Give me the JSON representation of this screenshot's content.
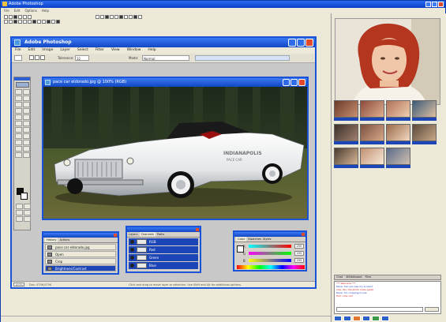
{
  "outer": {
    "title": "Adobe Photoshop",
    "menu": [
      "File",
      "Edit",
      "Options",
      "Help"
    ]
  },
  "photoshop": {
    "title": "Adobe Photoshop",
    "menu": [
      "File",
      "Edit",
      "Image",
      "Layer",
      "Select",
      "Filter",
      "View",
      "Window",
      "Help"
    ],
    "options": {
      "tolerance_label": "Tolerance:",
      "tolerance_value": "32",
      "mode_label": "Mode:",
      "mode_value": "Normal"
    }
  },
  "document": {
    "title": "pace car eldorado.jpg @ 100% (RGB)"
  },
  "history_palette": {
    "tabs": [
      "History",
      "Actions"
    ],
    "rows": [
      {
        "label": "pace car eldorado.jpg"
      },
      {
        "label": "Open"
      },
      {
        "label": "Crop"
      },
      {
        "label": "Brightness/Contrast"
      }
    ]
  },
  "layers_palette": {
    "tabs": [
      "Layers",
      "Channels",
      "Paths"
    ],
    "rows": [
      {
        "label": "RGB"
      },
      {
        "label": "Red"
      },
      {
        "label": "Green"
      },
      {
        "label": "Blue"
      }
    ]
  },
  "color_palette": {
    "tabs": [
      "Color",
      "Swatches",
      "Styles"
    ],
    "rows": [
      {
        "label": "R",
        "value": "255",
        "color": "#d83030"
      },
      {
        "label": "G",
        "value": "255",
        "color": "#30b030"
      },
      {
        "label": "B",
        "value": "255",
        "color": "#3050d0"
      }
    ]
  },
  "status": {
    "zoom": "100%",
    "doc": "Doc: 475K/475K",
    "hint": "Click and drag to move layer or selection. Use Shift and Alt for additional options."
  },
  "chat": {
    "tabs": [
      "Chat",
      "Whiteboard",
      "Files"
    ],
    "lines": [
      {
        "text": "*** Welcome ***",
        "style": "r"
      },
      {
        "text": "Dave: Can you see my screen?",
        "style": "b"
      },
      {
        "text": "Lisa: Yes, the photo looks great",
        "style": "r"
      },
      {
        "text": "Dave: I'm cropping it now",
        "style": "b"
      },
      {
        "text": "Tom: nice car!",
        "style": "r"
      }
    ]
  },
  "colors": {
    "xp_blue": "#1a52d8",
    "selection": "#1c46b8",
    "chrome": "#ece9d8"
  }
}
